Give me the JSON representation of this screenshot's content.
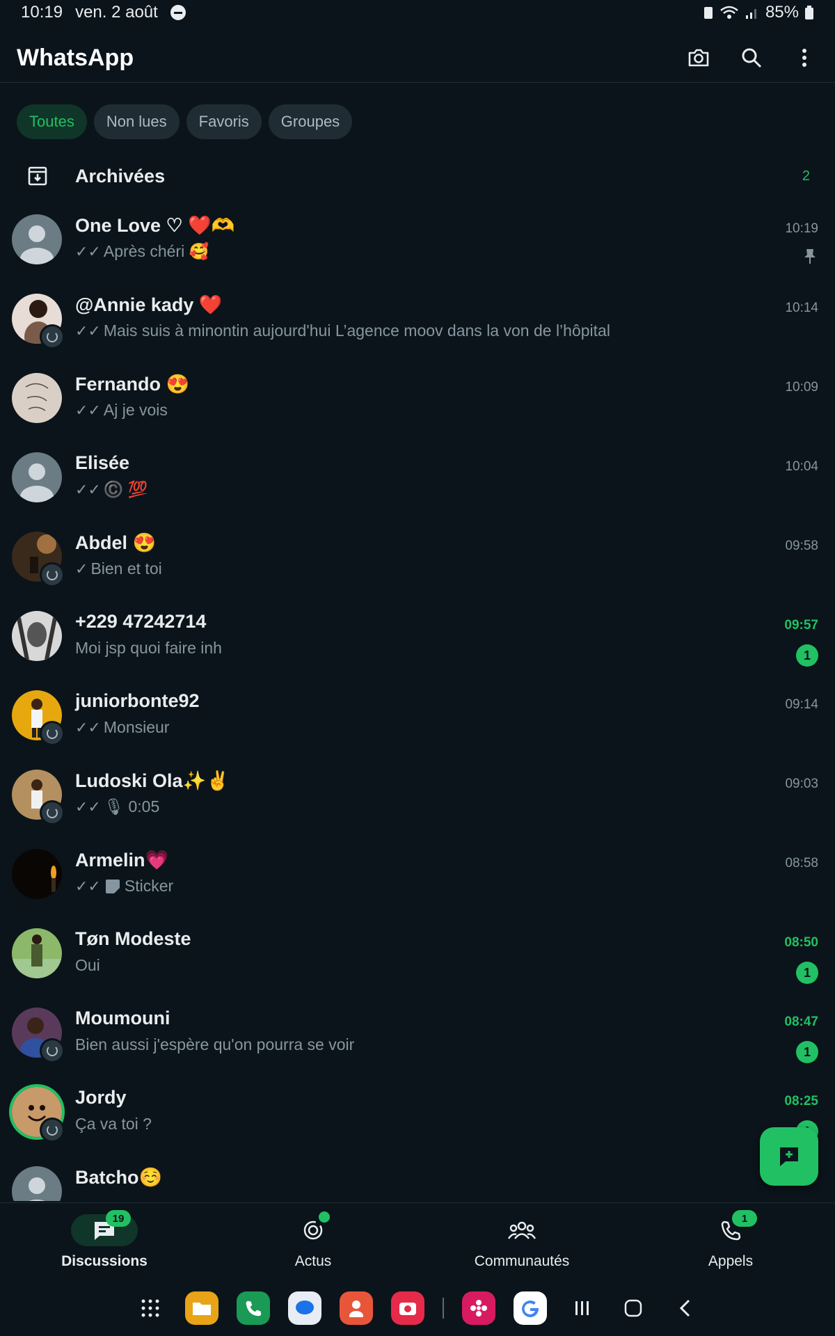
{
  "status": {
    "time": "10:19",
    "date": "ven. 2 août",
    "battery": "85%"
  },
  "app": {
    "title": "WhatsApp"
  },
  "filters": [
    {
      "label": "Toutes",
      "active": true
    },
    {
      "label": "Non lues",
      "active": false
    },
    {
      "label": "Favoris",
      "active": false
    },
    {
      "label": "Groupes",
      "active": false
    }
  ],
  "archived": {
    "label": "Archivées",
    "count": "2"
  },
  "chats": [
    {
      "name": "One Love ♡ ❤️🫶",
      "message": "Après chéri 🥰",
      "time": "10:19",
      "ticks": "✓✓",
      "pinned": true
    },
    {
      "name": "@Annie kady ❤️",
      "message": "Mais suis à minontin aujourd'hui  L’agence moov dans la von de l’hôpital",
      "time": "10:14",
      "ticks": "✓✓"
    },
    {
      "name": "Fernando 😍",
      "message": "Aj je vois",
      "time": "10:09",
      "ticks": "✓✓"
    },
    {
      "name": "Elisée",
      "message": "©️ 💯",
      "time": "10:04",
      "ticks": "✓✓"
    },
    {
      "name": "Abdel 😍",
      "message": "Bien et toi",
      "time": "09:58",
      "ticks": "✓"
    },
    {
      "name": "+229 47242714",
      "message": "Moi jsp quoi faire inh",
      "time": "09:57",
      "ticks": "",
      "unread": "1"
    },
    {
      "name": "juniorbonte92",
      "message": "Monsieur",
      "time": "09:14",
      "ticks": "✓✓"
    },
    {
      "name": "Ludoski Ola✨✌️",
      "message": "🎙 0:05",
      "time": "09:03",
      "ticks": "✓✓"
    },
    {
      "name": "Armelin💗",
      "message": "Sticker",
      "time": "08:58",
      "ticks": "✓✓"
    },
    {
      "name": "Tøn Modeste",
      "message": "Oui",
      "time": "08:50",
      "ticks": "",
      "unread": "1"
    },
    {
      "name": "Moumouni",
      "message": "Bien aussi j'espère qu'on pourra se voir",
      "time": "08:47",
      "ticks": "",
      "unread": "1"
    },
    {
      "name": "Jordy",
      "message": "Ça va toi ?",
      "time": "08:25",
      "ticks": "",
      "unread": "1"
    },
    {
      "name": "Batcho☺️",
      "message": "",
      "time": "",
      "ticks": ""
    }
  ],
  "nav": [
    {
      "label": "Discussions",
      "badge": "19",
      "active": true
    },
    {
      "label": "Actus",
      "dot": true
    },
    {
      "label": "Communautés"
    },
    {
      "label": "Appels",
      "badge": "1"
    }
  ],
  "colors": {
    "background": "#0b141a",
    "accent": "#21c063",
    "chip_bg": "#202c33"
  }
}
